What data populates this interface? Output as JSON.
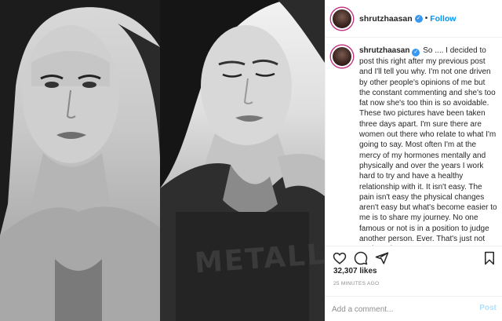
{
  "post": {
    "username": "shrutzhaasan",
    "follow_label": "Follow",
    "separator": "•",
    "verified_icon": "check-badge-icon",
    "photo_shirt_text": "METALLIC",
    "caption": "So .... I decided to post this right after my previous post and I'll tell you why. I'm not one driven by other people's opinions of me but the constant commenting and she's too fat now she's too thin is so avoidable. These two pictures have been taken three days apart. I'm sure there are women out there who relate to what I'm going to say. Most often I'm at the mercy of my hormones mentally and physically and over the years I work hard to try and have a healthy relationship with it. It isn't easy. The pain isn't easy the physical changes aren't easy but what's become easier to me is to share my journey. No one famous or not is in a position to judge another person. Ever. That's just not cool. I'm happy to say",
    "likes": "32,307 likes",
    "timestamp": "25 MINUTES AGO"
  },
  "comment": {
    "placeholder": "Add a comment...",
    "post_label": "Post"
  },
  "icons": {
    "like": "heart-icon",
    "comment": "comment-icon",
    "share": "share-icon",
    "save": "bookmark-icon"
  },
  "colors": {
    "accent": "#0095f6",
    "verified": "#3897f0",
    "muted": "#8e8e8e",
    "post_disabled": "#b2dffc"
  }
}
